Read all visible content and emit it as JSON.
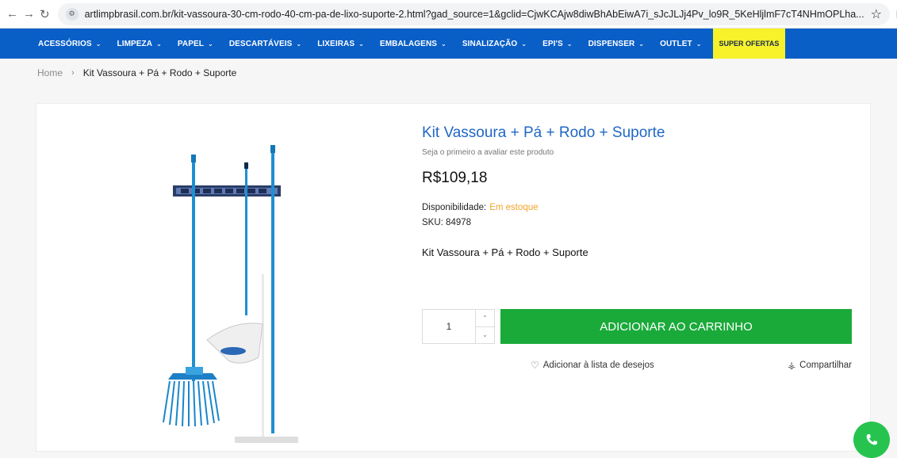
{
  "browser": {
    "url_host": "artlimpbrasil.com.br",
    "url_path": "/kit-vassoura-30-cm-rodo-40-cm-pa-de-lixo-suporte-2.html?gad_source=1&gclid=CjwKCAjw8diwBhAbEiwA7i_sJcJLJj4Pv_lo9R_5KeHljlmF7cT4NHmOPLha...",
    "ext_label": "R~"
  },
  "nav": {
    "items": [
      {
        "label": "ACESSÓRIOS"
      },
      {
        "label": "LIMPEZA"
      },
      {
        "label": "PAPEL"
      },
      {
        "label": "DESCARTÁVEIS"
      },
      {
        "label": "LIXEIRAS"
      },
      {
        "label": "EMBALAGENS"
      },
      {
        "label": "SINALIZAÇÃO"
      },
      {
        "label": "EPI'S"
      },
      {
        "label": "DISPENSER"
      },
      {
        "label": "OUTLET"
      }
    ],
    "super_offers": "SUPER OFERTAS"
  },
  "breadcrumb": {
    "home": "Home",
    "current": "Kit Vassoura + Pá + Rodo + Suporte"
  },
  "product": {
    "title": "Kit Vassoura + Pá + Rodo + Suporte",
    "review_prompt": "Seja o primeiro a avaliar este produto",
    "price": "R$109,18",
    "availability_label": "Disponibilidade:",
    "availability_value": "Em estoque",
    "sku_label": "SKU:",
    "sku_value": "84978",
    "short_description": "Kit Vassoura + Pá + Rodo + Suporte",
    "quantity": "1",
    "add_to_cart": "ADICIONAR AO CARRINHO",
    "wishlist": "Adicionar à lista de desejos",
    "share": "Compartilhar"
  },
  "colors": {
    "nav_bg": "#0a5fc7",
    "super_offers_bg": "#f7f22a",
    "add_to_cart_bg": "#1aaa3a",
    "stock_color": "#f0a52a",
    "title_color": "#1f67c6"
  }
}
